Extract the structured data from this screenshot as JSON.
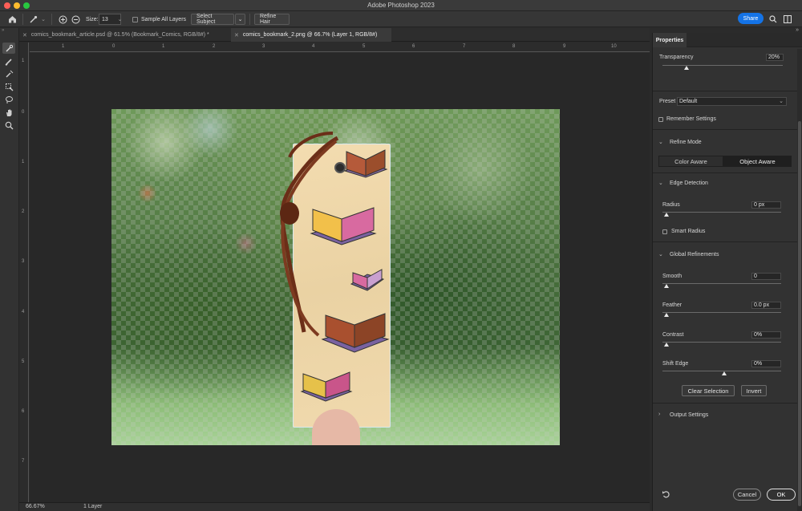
{
  "window": {
    "title": "Adobe Photoshop 2023"
  },
  "options_bar": {
    "size_label": "Size:",
    "size_value": "13",
    "sample_all_layers": "Sample All Layers",
    "select_subject": "Select Subject",
    "refine_hair": "Refine Hair",
    "share": "Share"
  },
  "tabs": [
    {
      "label": "comics_bookmark_article.psd @ 61.5% (Bookmark_Comics, RGB/8#) *",
      "active": false
    },
    {
      "label": "comics_bookmark_2.png @ 66.7% (Layer 1, RGB/8#)",
      "active": true
    }
  ],
  "rulers": {
    "top": [
      "1",
      "0",
      "1",
      "2",
      "3",
      "4",
      "5",
      "6",
      "7",
      "8",
      "9",
      "10"
    ],
    "left": [
      "1",
      "0",
      "1",
      "2",
      "3",
      "4",
      "5",
      "6",
      "7"
    ]
  },
  "status_bar": {
    "zoom": "66.67%",
    "layers": "1 Layer"
  },
  "properties": {
    "tab": "Properties",
    "transparency_label": "Transparency",
    "transparency_value": "20%",
    "preset_label": "Preset",
    "preset_value": "Default",
    "remember_settings": "Remember Settings",
    "refine_mode": "Refine Mode",
    "color_aware": "Color Aware",
    "object_aware": "Object Aware",
    "edge_detection": "Edge Detection",
    "radius_label": "Radius",
    "radius_value": "0 px",
    "smart_radius": "Smart Radius",
    "global_refinements": "Global Refinements",
    "smooth_label": "Smooth",
    "smooth_value": "0",
    "feather_label": "Feather",
    "feather_value": "0.0 px",
    "contrast_label": "Contrast",
    "contrast_value": "0%",
    "shift_edge_label": "Shift Edge",
    "shift_edge_value": "0%",
    "clear_selection": "Clear Selection",
    "invert": "Invert",
    "output_settings": "Output Settings",
    "cancel": "Cancel",
    "ok": "OK"
  },
  "colors": {
    "accent": "#1473e6",
    "panel": "#323232",
    "canvas": "#282828"
  }
}
